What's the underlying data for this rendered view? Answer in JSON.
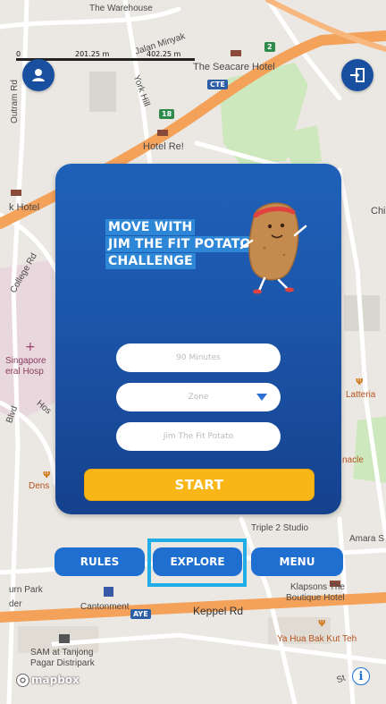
{
  "map": {
    "scale_labels": [
      "0",
      "201.25 m",
      "402.25 m"
    ],
    "places": {
      "warehouse": "The Warehouse",
      "jalan_minyak": "Jalan Minyak",
      "york_hill": "York Hill",
      "outram": "Outram Rd",
      "seacare": "The Seacare Hotel",
      "hotel_re": "Hotel Re!",
      "k_hotel": "k Hotel",
      "college_rd": "College Rd",
      "sgh_line1": "Singapore",
      "sgh_line2": "eral Hosp",
      "blvd": "Blvd",
      "hos": "Hos",
      "dens": "Dens",
      "chi": "Chi",
      "latteria": "Latteria",
      "nacle": "nacle",
      "triple2": "Triple 2 Studio",
      "amara": "Amara S",
      "urn_park": "urn Park",
      "der": "der",
      "cantonment": "Cantonment",
      "klapsons_line1": "Klapsons The",
      "klapsons_line2": "Boutique Hotel",
      "keppel": "Keppel Rd",
      "yahua": "Ya Hua Bak Kut Teh",
      "sam_line1": "SAM at Tanjong",
      "sam_line2": "Pagar Distripark",
      "st": "St"
    },
    "shields": {
      "cte": "CTE",
      "aye": "AYE",
      "exit18": "18",
      "exit2": "2"
    },
    "attribution": "mapbox",
    "colors": {
      "land": "#ebe8e3",
      "road_major": "#f4a15a",
      "road_minor": "#ffffff",
      "park": "#cde8bd",
      "hospital": "#e8d7dc",
      "building": "#d9d5cf"
    }
  },
  "top_left_button": {
    "icon": "user-location-icon"
  },
  "top_right_button": {
    "icon": "exit-icon"
  },
  "modal": {
    "title_lines": [
      "MOVE WITH",
      "JIM THE FIT POTATO",
      "CHALLENGE"
    ],
    "mascot": "potato-mascot",
    "duration_placeholder": "90 Minutes",
    "zone_placeholder": "Zone",
    "route_placeholder": "Jim The Fit Potato",
    "start_label": "START",
    "colors": {
      "start": "#f8b716",
      "panel": "#1c55a9"
    }
  },
  "bottom_nav": {
    "rules": "RULES",
    "explore": "EXPLORE",
    "menu": "MENU",
    "highlighted": "EXPLORE",
    "highlight_color": "#21aee8"
  },
  "info_button": {
    "icon": "info-icon",
    "label": "i"
  }
}
